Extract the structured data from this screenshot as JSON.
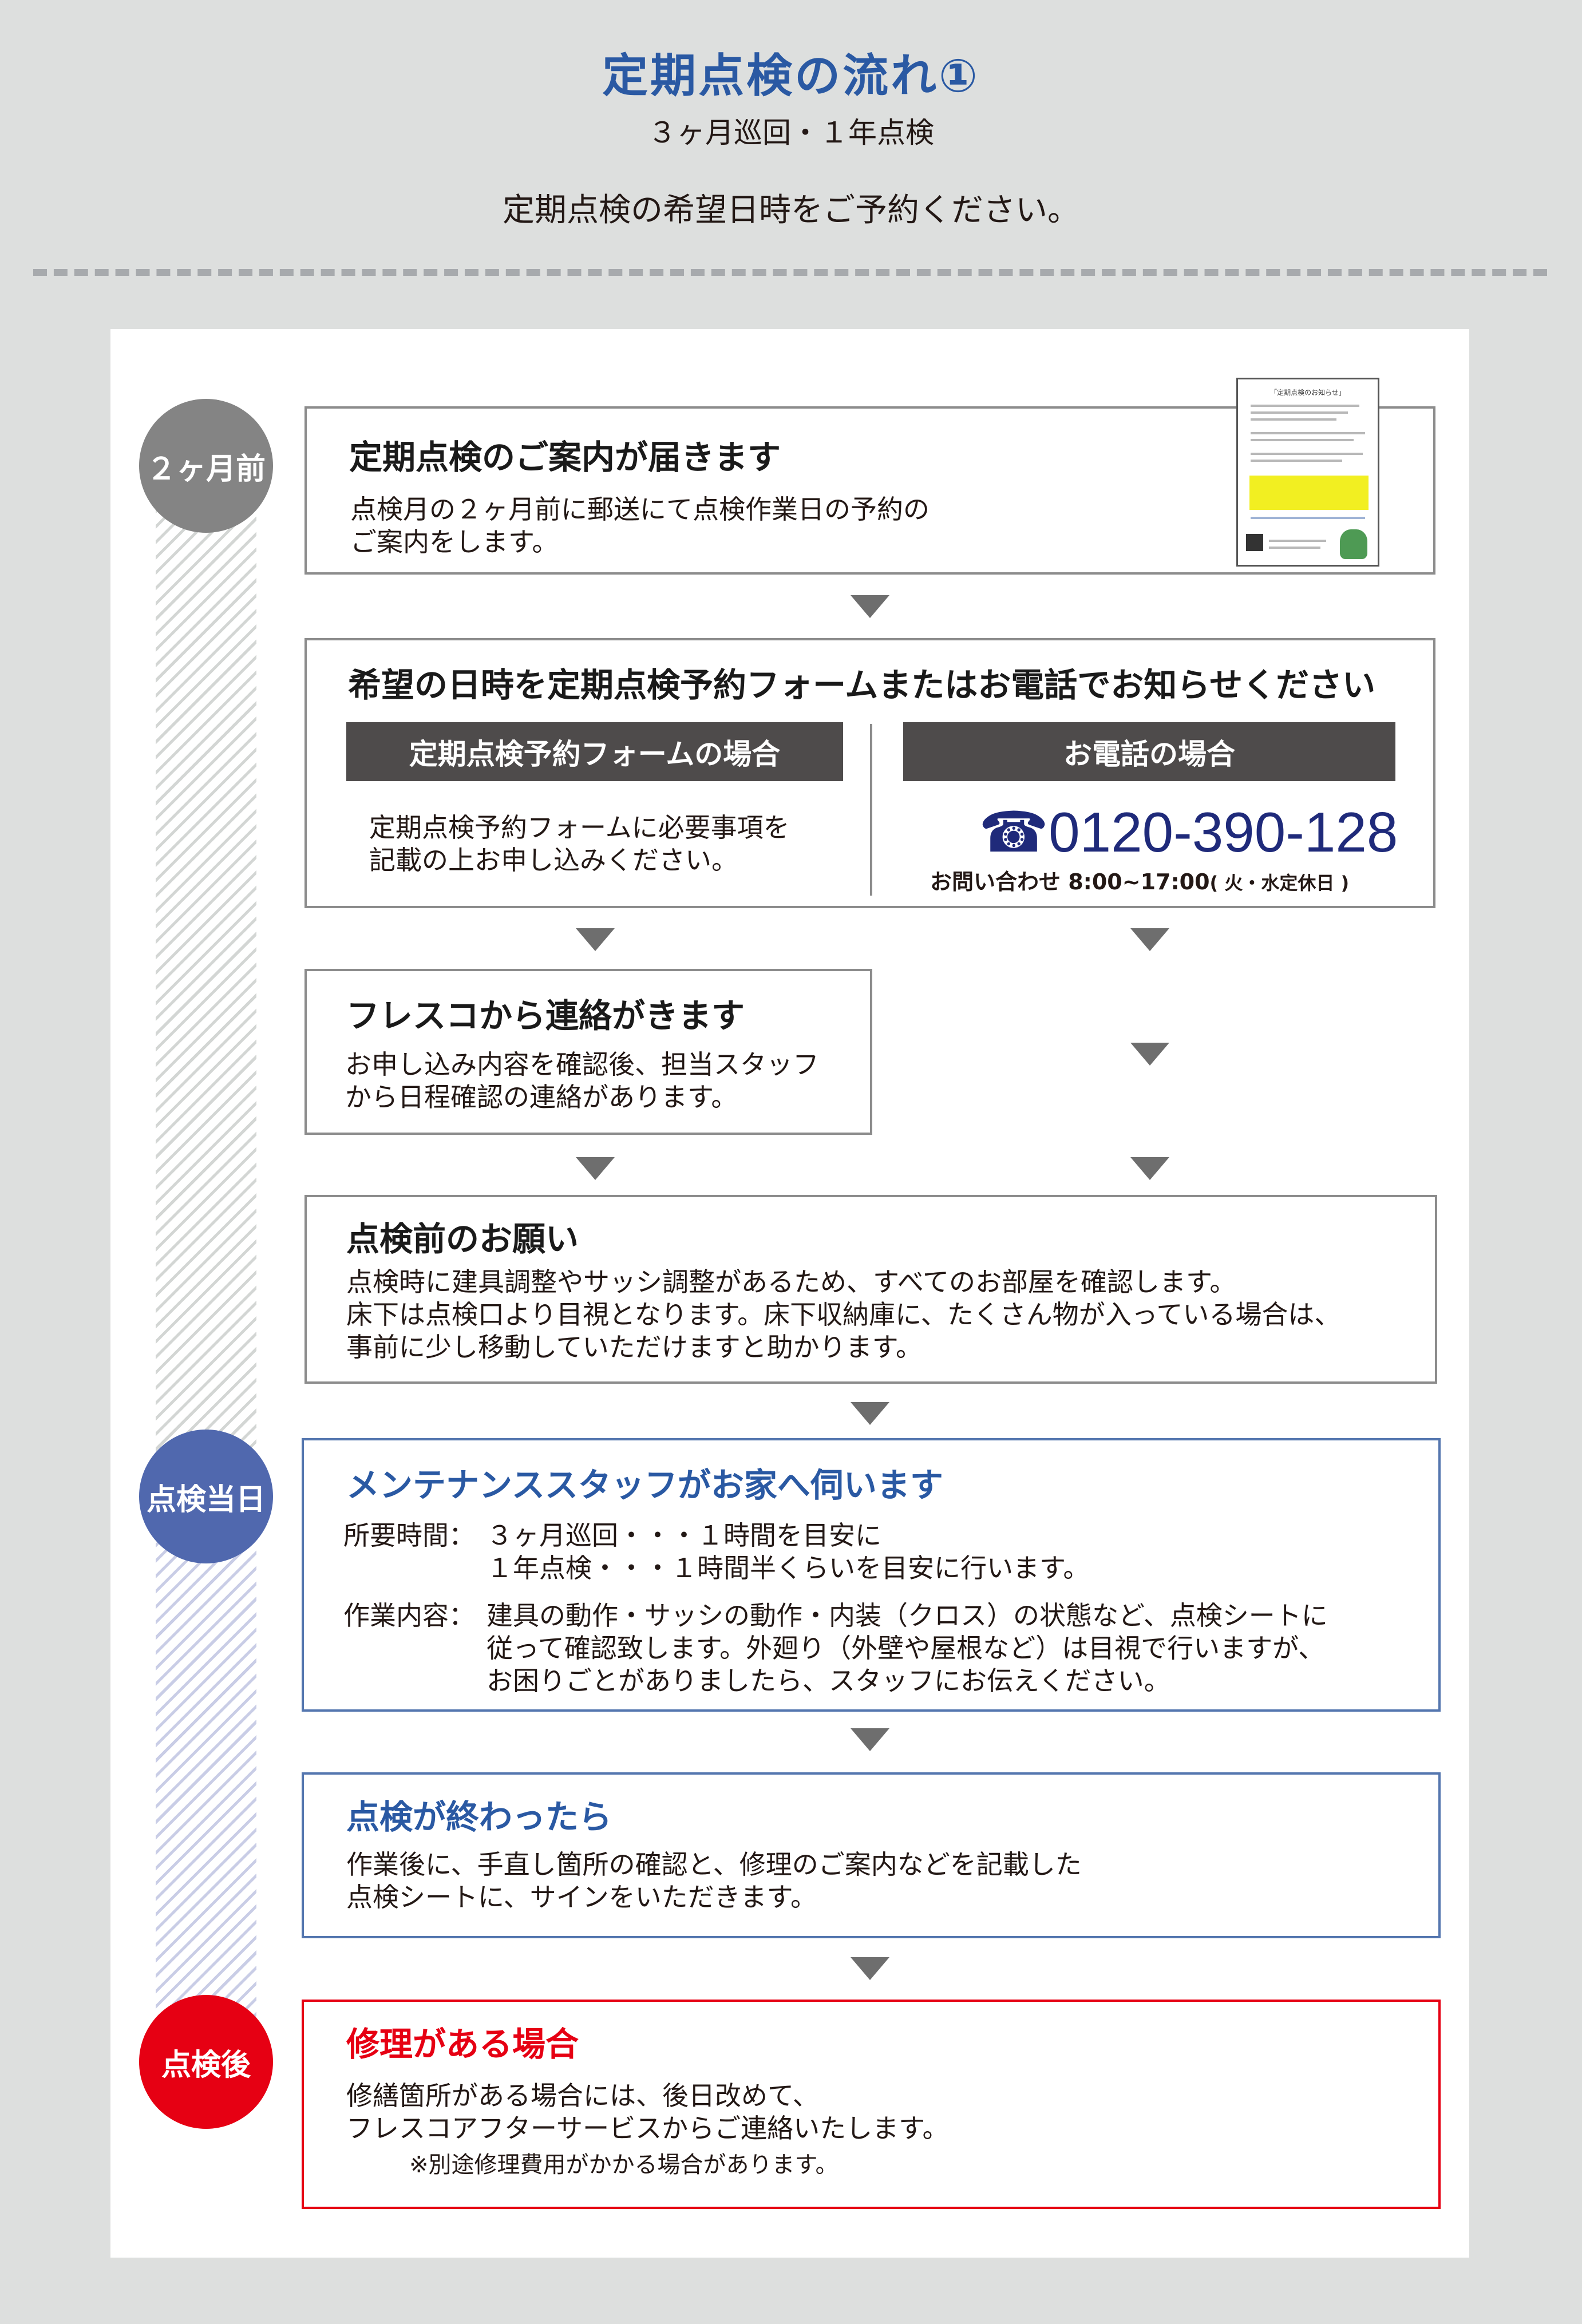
{
  "header": {
    "title": "定期点検の流れ①",
    "subtitle": "３ヶ月巡回・１年点検",
    "lead": "定期点検の希望日時をご予約ください。"
  },
  "stages": {
    "before": "２ヶ月前",
    "day": "点検当日",
    "after": "点検後"
  },
  "step1": {
    "title": "定期点検のご案内が届きます",
    "body": [
      "点検月の２ヶ月前に郵送にて点検作業日の予約の",
      "ご案内をします。"
    ],
    "doc_title": "「定期点検のお知らせ」"
  },
  "step2": {
    "title": "希望の日時を定期点検予約フォームまたはお電話でお知らせください",
    "form_header": "定期点検予約フォームの場合",
    "form_body": [
      "定期点検予約フォームに必要事項を",
      "記載の上お申し込みください。"
    ],
    "phone_header": "お電話の場合",
    "phone_number": "0120-390-128",
    "phone_hours": "お問い合わせ 8:00~17:00",
    "phone_closed": "( 火・水定休日 )"
  },
  "step3": {
    "title": "フレスコから連絡がきます",
    "body": [
      "お申し込み内容を確認後、担当スタッフ",
      "から日程確認の連絡があります。"
    ]
  },
  "step4": {
    "title": "点検前のお願い",
    "body": [
      "点検時に建具調整やサッシ調整があるため、すべてのお部屋を確認します。",
      "床下は点検口より目視となります。床下収納庫に、たくさん物が入っている場合は、",
      "事前に少し移動していただけますと助かります。"
    ]
  },
  "step5": {
    "title": "メンテナンススタッフがお家へ伺います",
    "time_label": "所要時間：",
    "time_lines": [
      "３ヶ月巡回・・・１時間を目安に",
      "１年点検・・・１時間半くらいを目安に行います。"
    ],
    "work_label": "作業内容：",
    "work_lines": [
      "建具の動作・サッシの動作・内装（クロス）の状態など、点検シートに",
      "従って確認致します。外廻り（外壁や屋根など）は目視で行いますが、",
      "お困りごとがありましたら、スタッフにお伝えください。"
    ]
  },
  "step6": {
    "title": "点検が終わったら",
    "body": [
      "作業後に、手直し箇所の確認と、修理のご案内などを記載した",
      "点検シートに、サインをいただきます。"
    ]
  },
  "step7": {
    "title": "修理がある場合",
    "body": [
      "修繕箇所がある場合には、後日改めて、",
      "フレスコアフターサービスからご連絡いたします。"
    ],
    "note": "※別途修理費用がかかる場合があります。"
  },
  "colors": {
    "title_blue": "#2a59a3",
    "before_gray": "#848484",
    "day_blue": "#5068ae",
    "after_red": "#e60013",
    "phone_navy": "#1f2a7a"
  }
}
